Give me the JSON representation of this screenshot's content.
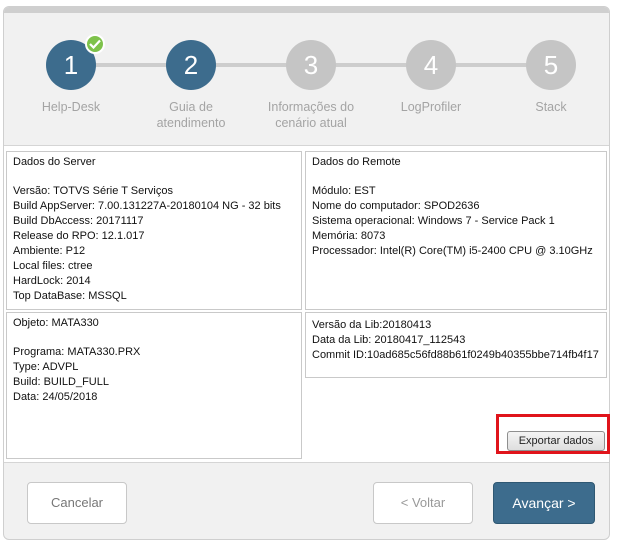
{
  "steps": [
    {
      "number": "1",
      "label": "Help-Desk",
      "state": "completed"
    },
    {
      "number": "2",
      "label": "Guia de atendimento",
      "state": "current"
    },
    {
      "number": "3",
      "label": "Informações do cenário atual",
      "state": "pending"
    },
    {
      "number": "4",
      "label": "LogProfiler",
      "state": "pending"
    },
    {
      "number": "5",
      "label": "Stack",
      "state": "pending"
    }
  ],
  "panels": {
    "server": {
      "title": "Dados do Server",
      "lines": [
        "Versão: TOTVS Série T Serviços",
        "Build AppServer: 7.00.131227A-20180104 NG - 32 bits",
        "Build DbAccess: 20171117",
        "Release do RPO:  12.1.017",
        "Ambiente: P12",
        "Local files: ctree",
        "HardLock: 2014",
        "Top DataBase: MSSQL"
      ]
    },
    "remote": {
      "title": "Dados do Remote",
      "lines": [
        "Módulo: EST",
        "Nome do computador: SPOD2636",
        "Sistema operacional: Windows 7 - Service Pack 1",
        "Memória: 8073",
        "Processador: Intel(R) Core(TM) i5-2400 CPU @ 3.10GHz"
      ]
    },
    "object": {
      "title": "Objeto: MATA330",
      "lines": [
        "Programa: MATA330.PRX",
        "Type: ADVPL",
        "Build: BUILD_FULL",
        "Data: 24/05/2018"
      ]
    },
    "lib": {
      "lines": [
        "Versão da Lib:20180413",
        "Data da Lib: 20180417_112543",
        "Commit ID:10ad685c56fd88b61f0249b40355bbe714fb4f17"
      ]
    }
  },
  "buttons": {
    "export": "Exportar dados",
    "cancel": "Cancelar",
    "back": "< Voltar",
    "next": "Avançar >"
  },
  "colors": {
    "active_step": "#3d6c8d",
    "inactive_step": "#c5c5c5",
    "check": "#7ec24b",
    "highlight": "#e0141b"
  }
}
